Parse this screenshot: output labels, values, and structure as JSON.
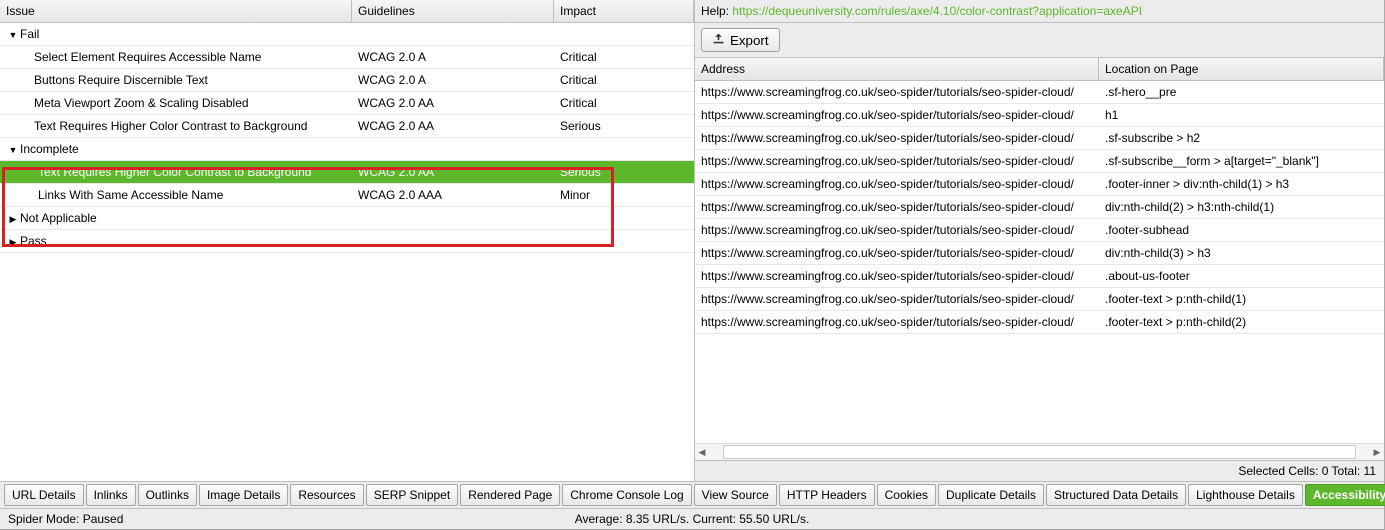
{
  "left": {
    "columns": {
      "issue": "Issue",
      "guidelines": "Guidelines",
      "impact": "Impact"
    },
    "fail": {
      "label": "Fail",
      "expanded": true,
      "items": [
        {
          "issue": "Select Element Requires Accessible Name",
          "guidelines": "WCAG 2.0 A",
          "impact": "Critical"
        },
        {
          "issue": "Buttons Require Discernible Text",
          "guidelines": "WCAG 2.0 A",
          "impact": "Critical"
        },
        {
          "issue": "Meta Viewport Zoom & Scaling Disabled",
          "guidelines": "WCAG 2.0 AA",
          "impact": "Critical"
        },
        {
          "issue": "Text Requires Higher Color Contrast to Background",
          "guidelines": "WCAG 2.0 AA",
          "impact": "Serious"
        }
      ]
    },
    "incomplete": {
      "label": "Incomplete",
      "expanded": true,
      "items": [
        {
          "issue": "Text Requires Higher Color Contrast to Background",
          "guidelines": "WCAG 2.0 AA",
          "impact": "Serious",
          "selected": true
        },
        {
          "issue": "Links With Same Accessible Name",
          "guidelines": "WCAG 2.0 AAA",
          "impact": "Minor"
        }
      ]
    },
    "notapplicable": {
      "label": "Not Applicable",
      "expanded": false
    },
    "pass": {
      "label": "Pass",
      "expanded": false
    }
  },
  "right": {
    "help_label": "Help: ",
    "help_link": "https://dequeuniversity.com/rules/axe/4.10/color-contrast?application=axeAPI",
    "export": "Export",
    "columns": {
      "address": "Address",
      "location": "Location on Page"
    },
    "rows": [
      {
        "address": "https://www.screamingfrog.co.uk/seo-spider/tutorials/seo-spider-cloud/",
        "location": ".sf-hero__pre"
      },
      {
        "address": "https://www.screamingfrog.co.uk/seo-spider/tutorials/seo-spider-cloud/",
        "location": "h1"
      },
      {
        "address": "https://www.screamingfrog.co.uk/seo-spider/tutorials/seo-spider-cloud/",
        "location": ".sf-subscribe > h2"
      },
      {
        "address": "https://www.screamingfrog.co.uk/seo-spider/tutorials/seo-spider-cloud/",
        "location": ".sf-subscribe__form > a[target=\"_blank\"]"
      },
      {
        "address": "https://www.screamingfrog.co.uk/seo-spider/tutorials/seo-spider-cloud/",
        "location": ".footer-inner > div:nth-child(1) > h3"
      },
      {
        "address": "https://www.screamingfrog.co.uk/seo-spider/tutorials/seo-spider-cloud/",
        "location": "div:nth-child(2) > h3:nth-child(1)"
      },
      {
        "address": "https://www.screamingfrog.co.uk/seo-spider/tutorials/seo-spider-cloud/",
        "location": ".footer-subhead"
      },
      {
        "address": "https://www.screamingfrog.co.uk/seo-spider/tutorials/seo-spider-cloud/",
        "location": "div:nth-child(3) > h3"
      },
      {
        "address": "https://www.screamingfrog.co.uk/seo-spider/tutorials/seo-spider-cloud/",
        "location": ".about-us-footer"
      },
      {
        "address": "https://www.screamingfrog.co.uk/seo-spider/tutorials/seo-spider-cloud/",
        "location": ".footer-text > p:nth-child(1)"
      },
      {
        "address": "https://www.screamingfrog.co.uk/seo-spider/tutorials/seo-spider-cloud/",
        "location": ".footer-text > p:nth-child(2)"
      }
    ],
    "selected_info": "Selected Cells:  0  Total:  11"
  },
  "tabs": [
    "URL Details",
    "Inlinks",
    "Outlinks",
    "Image Details",
    "Resources",
    "SERP Snippet",
    "Rendered Page",
    "Chrome Console Log",
    "View Source",
    "HTTP Headers",
    "Cookies",
    "Duplicate Details",
    "Structured Data Details",
    "Lighthouse Details",
    "Accessibility Details"
  ],
  "active_tab": "Accessibility Details",
  "status": {
    "mode": "Spider Mode: Paused",
    "rate": "Average: 8.35 URL/s. Current: 55.50 URL/s."
  }
}
